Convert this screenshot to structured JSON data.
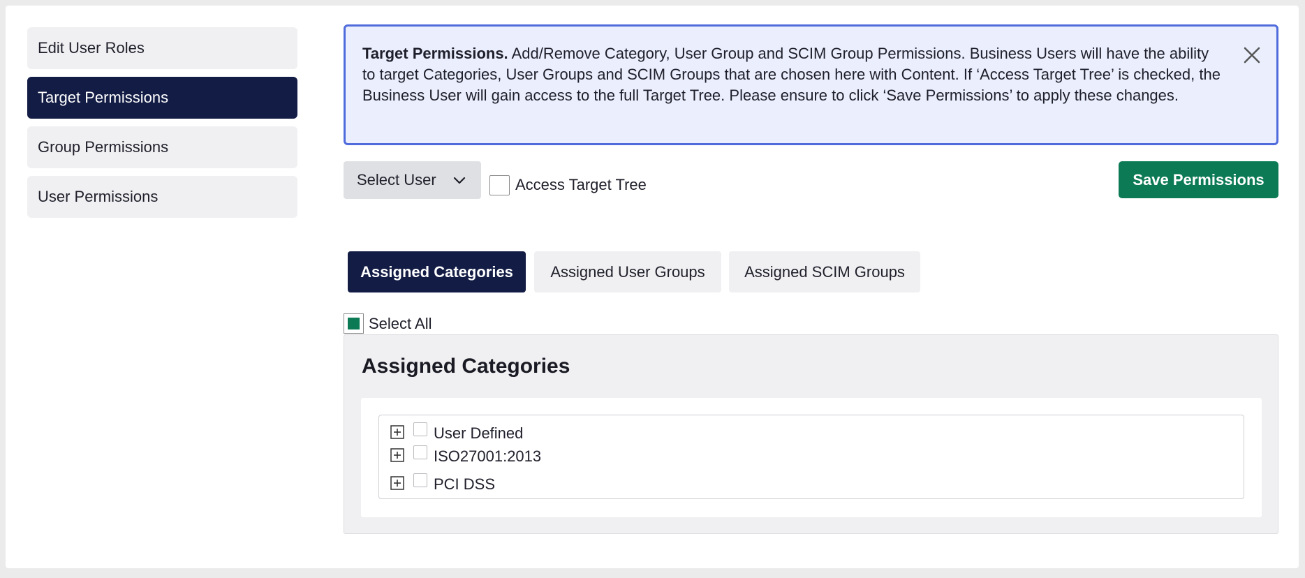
{
  "sidebar": {
    "items": [
      {
        "label": "Edit User Roles"
      },
      {
        "label": "Target Permissions"
      },
      {
        "label": "Group Permissions"
      },
      {
        "label": "User Permissions"
      }
    ],
    "active_index": 1
  },
  "banner": {
    "title": "Target Permissions.",
    "text": " Add/Remove Category, User Group and SCIM Group Permissions. Business Users will have the ability to target Categories, User Groups and SCIM Groups that are chosen here with Content. If ‘Access Target Tree’ is checked, the Business User will gain access to the full Target Tree. Please ensure to click ‘Save Permissions’ to apply these changes.",
    "close_icon": "close-icon"
  },
  "controls": {
    "select_user_label": "Select User",
    "access_target_tree_label": "Access Target Tree",
    "access_target_tree_checked": false,
    "save_label": "Save Permissions"
  },
  "tabs": [
    {
      "label": "Assigned Categories"
    },
    {
      "label": "Assigned User Groups"
    },
    {
      "label": "Assigned SCIM Groups"
    }
  ],
  "select_all": {
    "label": "Select All",
    "checked": true
  },
  "categories": {
    "title": "Assigned Categories",
    "tree": [
      {
        "label": "User Defined",
        "checked": false
      },
      {
        "label": "ISO27001:2013",
        "checked": false
      },
      {
        "label": "PCI DSS",
        "checked": false
      }
    ]
  },
  "colors": {
    "primary_dark": "#131c45",
    "accent_green": "#0b7a55",
    "banner_bg": "#eaeefd",
    "banner_border": "#4f6bdc"
  }
}
